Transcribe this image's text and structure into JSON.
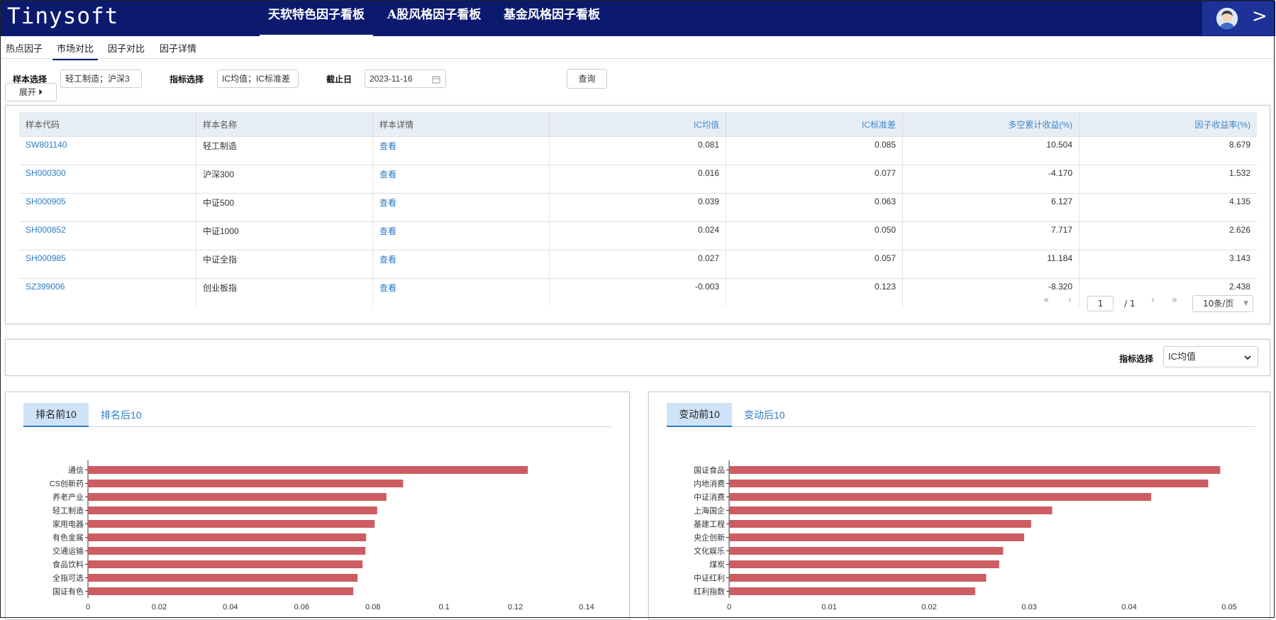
{
  "app": {
    "logo": "Tinysoft"
  },
  "nav": {
    "tabs": [
      {
        "label": "天软特色因子看板",
        "active": true
      },
      {
        "label": "A股风格因子看板",
        "active": false
      },
      {
        "label": "基金风格因子看板",
        "active": false
      }
    ],
    "user_chevron": ">"
  },
  "subtabs": [
    {
      "label": "热点因子",
      "active": false
    },
    {
      "label": "市场对比",
      "active": true
    },
    {
      "label": "因子对比",
      "active": false
    },
    {
      "label": "因子详情",
      "active": false
    }
  ],
  "filter": {
    "sample_label": "样本选择",
    "sample_value": "轻工制造；沪深3",
    "indicator_label": "指标选择",
    "indicator_value": "IC均值；IC标准差",
    "date_label": "截止日",
    "date_value": "2023-11-16",
    "query_button": "查询",
    "expand_button": "展开 ⏵"
  },
  "table": {
    "headers": [
      "样本代码",
      "样本名称",
      "样本详情",
      "IC均值",
      "IC标准差",
      "多空累计收益(%)",
      "因子收益率(%)"
    ],
    "rows": [
      {
        "code": "SW801140",
        "name": "轻工制造",
        "detail": "查看",
        "ic_mean": "0.081",
        "ic_std": "0.085",
        "ls_return": "10.504",
        "factor_return": "8.679"
      },
      {
        "code": "SH000300",
        "name": "沪深300",
        "detail": "查看",
        "ic_mean": "0.016",
        "ic_std": "0.077",
        "ls_return": "-4.170",
        "factor_return": "1.532"
      },
      {
        "code": "SH000905",
        "name": "中证500",
        "detail": "查看",
        "ic_mean": "0.039",
        "ic_std": "0.063",
        "ls_return": "6.127",
        "factor_return": "4.135"
      },
      {
        "code": "SH000852",
        "name": "中证1000",
        "detail": "查看",
        "ic_mean": "0.024",
        "ic_std": "0.050",
        "ls_return": "7.717",
        "factor_return": "2.626"
      },
      {
        "code": "SH000985",
        "name": "中证全指",
        "detail": "查看",
        "ic_mean": "0.027",
        "ic_std": "0.057",
        "ls_return": "11.184",
        "factor_return": "3.143"
      },
      {
        "code": "SZ399006",
        "name": "创业板指",
        "detail": "查看",
        "ic_mean": "-0.003",
        "ic_std": "0.123",
        "ls_return": "-8.320",
        "factor_return": "2.438"
      }
    ]
  },
  "pagination": {
    "first": "«",
    "prev": "‹",
    "page": "1",
    "total": "/ 1",
    "next": "›",
    "last": "»",
    "page_size": "10条/页"
  },
  "indicator_bar": {
    "label": "指标选择",
    "value": "IC均值"
  },
  "left_panel": {
    "tab_active": "排名前10",
    "tab_inactive": "排名后10"
  },
  "right_panel": {
    "tab_active": "变动前10",
    "tab_inactive": "变动后10"
  },
  "colors": {
    "bar": "#cd5c63",
    "nav": "#0c1a6e",
    "link": "#2b7cc4"
  },
  "chart_data": [
    {
      "type": "bar",
      "orientation": "horizontal",
      "categories": [
        "通信",
        "CS创新药",
        "养老产业",
        "轻工制造",
        "家用电器",
        "有色金属",
        "交通运输",
        "食品饮料",
        "全指可选",
        "国证有色"
      ],
      "values": [
        0.1235,
        0.0885,
        0.0838,
        0.0812,
        0.0805,
        0.0781,
        0.0779,
        0.0771,
        0.0757,
        0.0745
      ],
      "xticks": [
        "0",
        "0.02",
        "0.04",
        "0.06",
        "0.08",
        "0.1",
        "0.12",
        "0.14"
      ],
      "xlim": [
        0,
        0.14
      ]
    },
    {
      "type": "bar",
      "orientation": "horizontal",
      "categories": [
        "国证食品",
        "内地消费",
        "中证消费",
        "上海国企",
        "基建工程",
        "央企创新",
        "文化娱乐",
        "煤炭",
        "中证红利",
        "红利指数"
      ],
      "values": [
        0.0491,
        0.0479,
        0.0422,
        0.0323,
        0.0302,
        0.0295,
        0.0274,
        0.027,
        0.0257,
        0.0246
      ],
      "xticks": [
        "0",
        "0.01",
        "0.02",
        "0.03",
        "0.04",
        "0.05"
      ],
      "xlim": [
        0,
        0.05
      ]
    }
  ]
}
